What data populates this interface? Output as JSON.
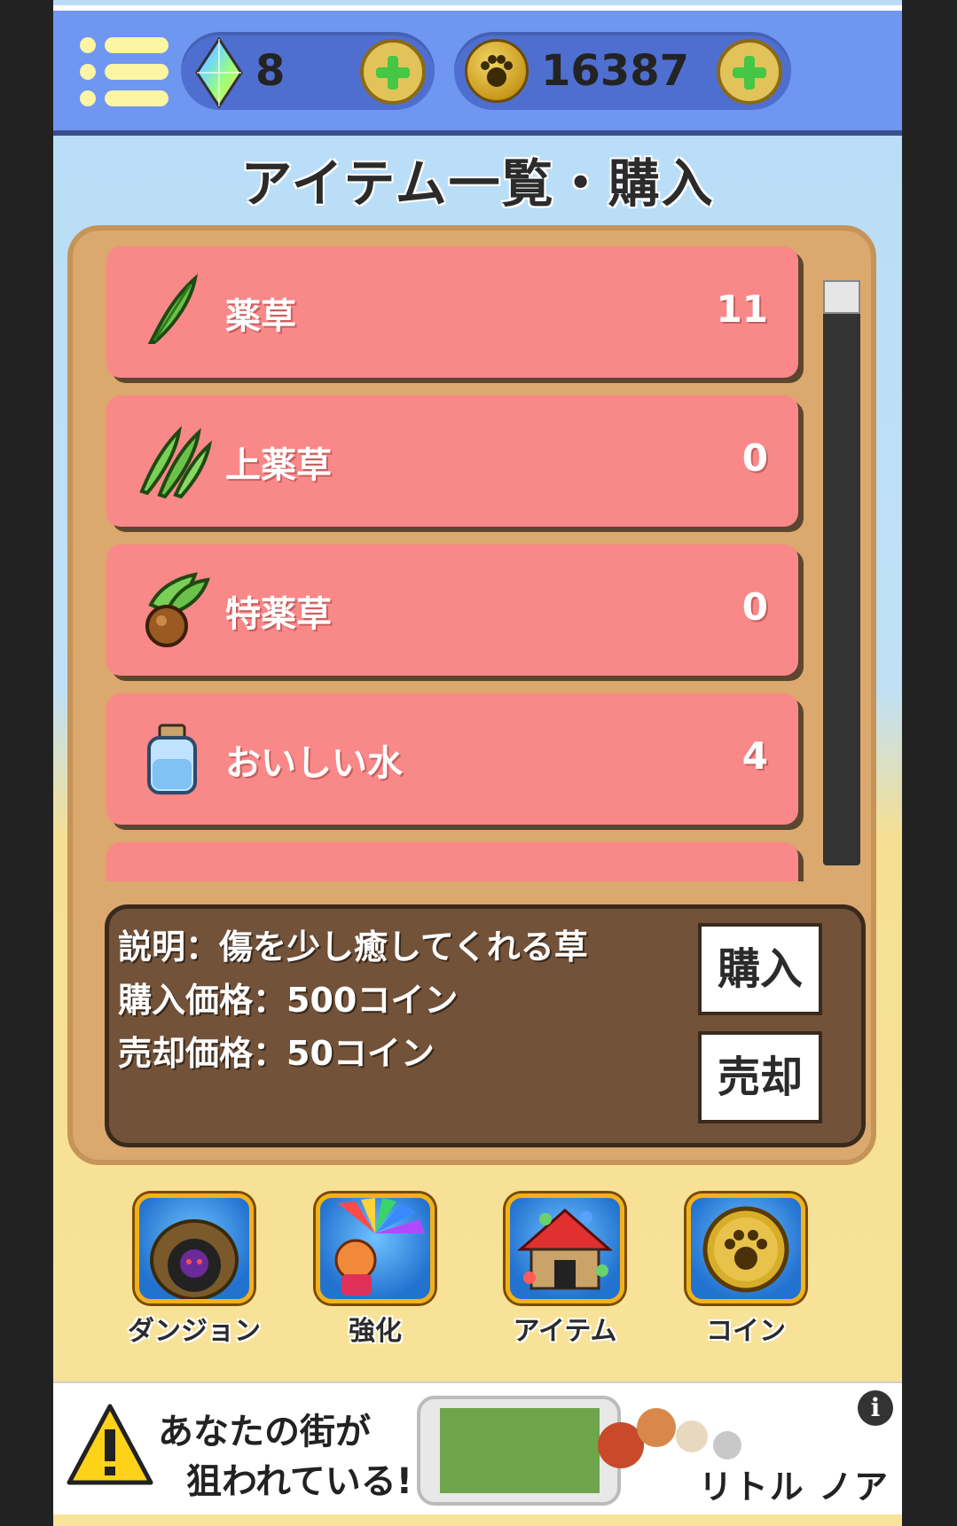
{
  "header": {
    "gems": "8",
    "coins": "16387",
    "plus_symbol": "+"
  },
  "page_title": "アイテム一覧・購入",
  "items": [
    {
      "name": "薬草",
      "count": "11",
      "icon": "herb-icon"
    },
    {
      "name": "上薬草",
      "count": "0",
      "icon": "herb-bundle-icon"
    },
    {
      "name": "特薬草",
      "count": "0",
      "icon": "herb-bulb-icon"
    },
    {
      "name": "おいしい水",
      "count": "4",
      "icon": "water-bottle-icon"
    },
    {
      "name": "",
      "count": "",
      "icon": ""
    }
  ],
  "details": {
    "description": "説明：傷を少し癒してくれる草",
    "buy_price": "購入価格：500コイン",
    "sell_price": "売却価格：50コイン",
    "buy_button": "購入",
    "sell_button": "売却"
  },
  "nav": [
    {
      "label": "ダンジョン",
      "icon": "dungeon-icon"
    },
    {
      "label": "強化",
      "icon": "power-up-icon"
    },
    {
      "label": "アイテム",
      "icon": "item-house-icon"
    },
    {
      "label": "コイン",
      "icon": "paw-coin-icon"
    }
  ],
  "ad": {
    "line1": "あなたの街が",
    "line2": "狙われている!",
    "brand": "リトル ノア",
    "info": "i"
  },
  "colors": {
    "topbar": "#6f96f0",
    "item_bg": "#f98888",
    "panel": "#dba86d",
    "info_bg": "#73523a"
  }
}
